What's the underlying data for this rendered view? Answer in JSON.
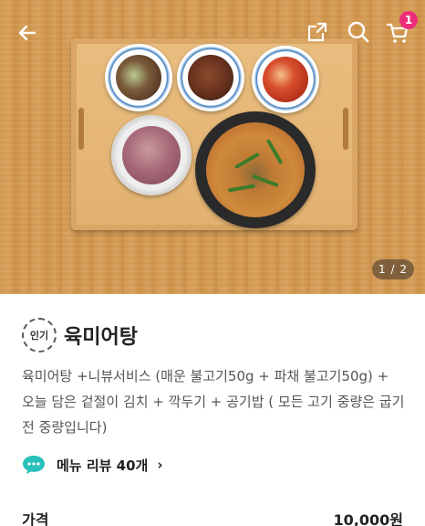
{
  "hero": {
    "page_indicator": "1 / 2"
  },
  "topbar": {
    "back_icon": "arrow-left-icon",
    "share_icon": "share-icon",
    "search_icon": "search-icon",
    "cart_icon": "cart-icon",
    "cart_count": "1",
    "badge_color": "#ee2d7a"
  },
  "menu": {
    "popular_badge": "인기",
    "title": "육미어탕",
    "description": "육미어탕 +니뷰서비스 (매운 불고기50g + 파채 불고기50g) + 오늘 담은 겉절이 김치 + 깍두기 + 공기밥 ( 모든 고기 중량은 굽기 전 중량입니다)",
    "review_link": "메뉴 리뷰 40개",
    "review_icon": "chat-bubble-icon",
    "review_icon_color": "#2ac1bc"
  },
  "price": {
    "label": "가격",
    "value": "10,000원"
  }
}
